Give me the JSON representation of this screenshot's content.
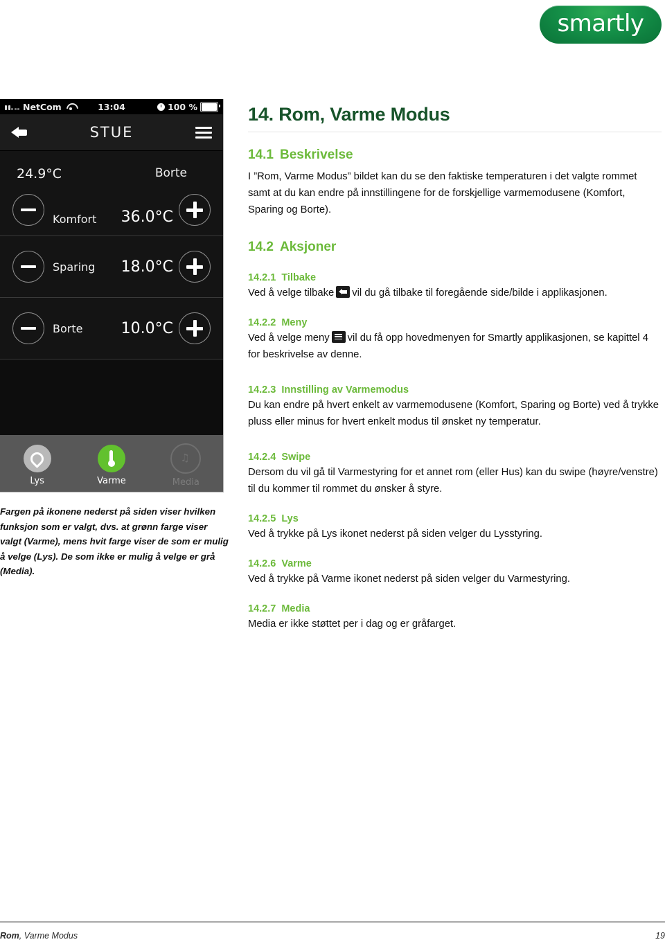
{
  "brand": {
    "logo_text": "smartly"
  },
  "phone": {
    "statusbar": {
      "carrier": "NetCom",
      "time": "13:04",
      "battery_pct": "100 %",
      "signal_icon": "signal-bars-icon",
      "wifi_icon": "wifi-icon",
      "clock_icon": "alarm-clock-icon",
      "battery_icon": "battery-icon"
    },
    "navbar": {
      "title": "STUE",
      "back_icon": "back-arrow-icon",
      "menu_icon": "hamburger-menu-icon"
    },
    "readout": {
      "actual_temperature": "24.9°C",
      "away_label": "Borte"
    },
    "modes": [
      {
        "name": "Komfort",
        "temperature": "36.0°C",
        "minus_icon": "minus-icon",
        "plus_icon": "plus-icon"
      },
      {
        "name": "Sparing",
        "temperature": "18.0°C",
        "minus_icon": "minus-icon",
        "plus_icon": "plus-icon"
      },
      {
        "name": "Borte",
        "temperature": "10.0°C",
        "minus_icon": "minus-icon",
        "plus_icon": "plus-icon"
      }
    ],
    "tabs": [
      {
        "label": "Lys",
        "icon": "location-pin-icon",
        "state": "available"
      },
      {
        "label": "Varme",
        "icon": "thermometer-icon",
        "state": "selected"
      },
      {
        "label": "Media",
        "icon": "music-note-icon",
        "state": "disabled"
      }
    ]
  },
  "caption": "Fargen på ikonene nederst på siden viser hvilken funksjon som er valgt, dvs. at grønn farge viser valgt (Varme), mens hvit farge viser de som er mulig å velge (Lys). De som ikke er mulig å velge er grå (Media).",
  "doc": {
    "title": "14. Rom, Varme Modus",
    "s1": {
      "num": "14.1",
      "heading": "Beskrivelse",
      "body": "I ”Rom, Varme Modus” bildet kan du se den faktiske temperaturen i det valgte rommet samt at du kan endre på innstillingene for de forskjellige varmemodusene (Komfort, Sparing og Borte)."
    },
    "s2": {
      "num": "14.2",
      "heading": "Aksjoner"
    },
    "s21": {
      "num": "14.2.1",
      "heading": "Tilbake",
      "body_before": "Ved å velge tilbake",
      "body_after": "vil du gå tilbake til foregående side/bilde i applikasjonen.",
      "icon": "back-arrow-icon"
    },
    "s22": {
      "num": "14.2.2",
      "heading": "Meny",
      "body_before": "Ved å velge meny",
      "body_after": "vil du få opp hovedmenyen for Smartly applikasjonen, se kapittel 4 for beskrivelse av denne.",
      "icon": "hamburger-menu-icon"
    },
    "s23": {
      "num": "14.2.3",
      "heading": "Innstilling av Varmemodus",
      "body": "Du kan endre på hvert enkelt av varmemodusene (Komfort, Sparing og Borte) ved å trykke pluss eller minus for hvert enkelt modus til ønsket ny temperatur."
    },
    "s24": {
      "num": "14.2.4",
      "heading": "Swipe",
      "body": "Dersom du vil gå til Varmestyring for et annet rom (eller Hus) kan du swipe (høyre/venstre) til du kommer til rommet du ønsker å styre."
    },
    "s25": {
      "num": "14.2.5",
      "heading": "Lys",
      "body": "Ved å trykke på Lys ikonet nederst på siden velger du Lysstyring."
    },
    "s26": {
      "num": "14.2.6",
      "heading": "Varme",
      "body": "Ved å trykke på Varme ikonet nederst på siden velger du Varmestyring."
    },
    "s27": {
      "num": "14.2.7",
      "heading": "Media",
      "body": "Media er ikke støttet per i dag og er gråfarget."
    }
  },
  "footer": {
    "left_bold": "Rom",
    "left_rest": ", Varme Modus",
    "page": "19"
  },
  "colors": {
    "title_green": "#17532a",
    "heading_green": "#6cba3b",
    "brand_green": "#11924a",
    "accent_tab_green": "#62c12e"
  }
}
